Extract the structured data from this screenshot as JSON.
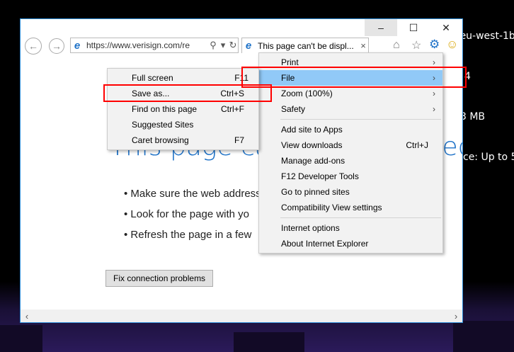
{
  "desktop_info": {
    "lines": [
      "Availability Zone: eu-west-1b",
      "4",
      "3 MB",
      "ce: Up to 5"
    ]
  },
  "window_controls": {
    "minimize": "–",
    "maximize": "☐",
    "close": "✕"
  },
  "address_bar": {
    "url": "https://www.verisign.com/re"
  },
  "tab": {
    "title": "This page can't be displ..."
  },
  "page": {
    "heading": "This page can't be displayed",
    "bullets": [
      "Make sure the web address",
      "Look for the page with yo",
      "Refresh the page in a few"
    ],
    "fix_button": "Fix connection problems"
  },
  "tools_menu": {
    "print": "Print",
    "file": "File",
    "zoom": "Zoom (100%)",
    "safety": "Safety",
    "add_to_apps": "Add site to Apps",
    "view_downloads": "View downloads",
    "view_downloads_shortcut": "Ctrl+J",
    "manage_addons": "Manage add-ons",
    "f12_tools": "F12 Developer Tools",
    "pinned_sites": "Go to pinned sites",
    "compat_view": "Compatibility View settings",
    "internet_options": "Internet options",
    "about_ie": "About Internet Explorer"
  },
  "file_submenu": {
    "full_screen": "Full screen",
    "full_screen_shortcut": "F11",
    "save_as": "Save as...",
    "save_as_shortcut": "Ctrl+S",
    "find": "Find on this page",
    "find_shortcut": "Ctrl+F",
    "suggested": "Suggested Sites",
    "caret": "Caret browsing",
    "caret_shortcut": "F7"
  }
}
